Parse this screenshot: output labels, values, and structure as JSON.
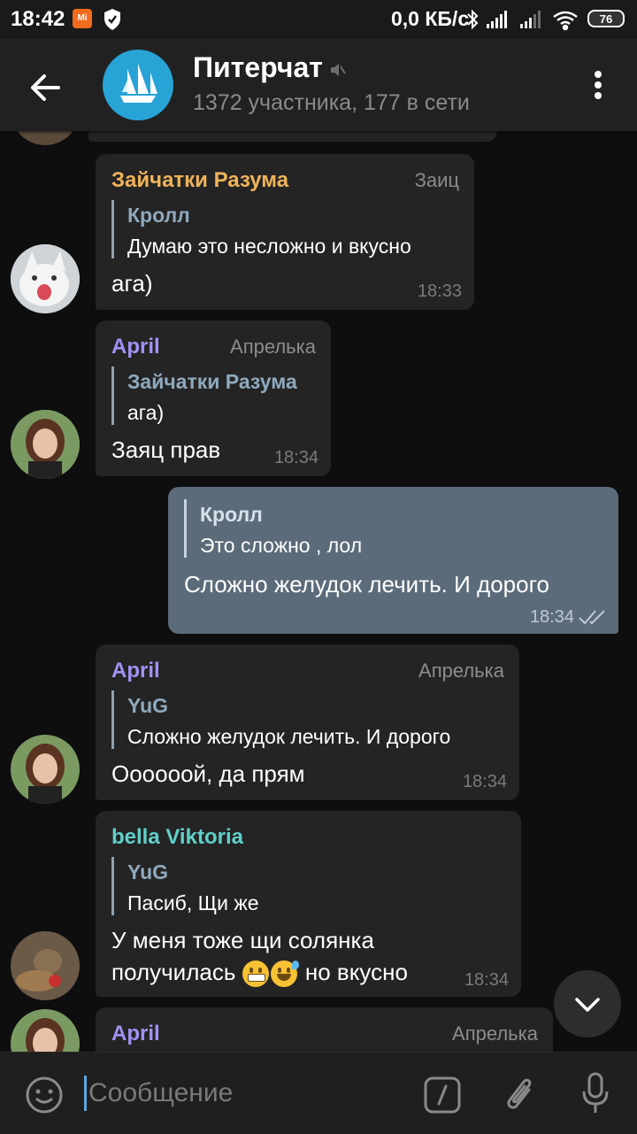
{
  "status": {
    "time": "18:42",
    "network": "0,0 КБ/с",
    "battery": "76",
    "mi_label": "Mi"
  },
  "header": {
    "title": "Питерчат",
    "subtitle": "1372 участника, 177 в сети"
  },
  "messages": [
    {
      "sender": "Зайчатки Разума",
      "alias": "Заиц",
      "reply_name": "Кролл",
      "reply_text": "Думаю это несложно и вкусно",
      "text": "ага)",
      "time": "18:33"
    },
    {
      "sender": "April",
      "alias": "Апрелька",
      "reply_name": "Зайчатки Разума",
      "reply_text": "ага)",
      "text": "Заяц прав",
      "time": "18:34"
    },
    {
      "reply_name": "Кролл",
      "reply_text": "Это сложно , лол",
      "text": "Сложно желудок лечить. И дорого",
      "time": "18:34"
    },
    {
      "sender": "April",
      "alias": "Апрелька",
      "reply_name": "YuG",
      "reply_text": "Сложно желудок лечить. И дорого",
      "text": "Оооооой, да прям",
      "time": "18:34"
    },
    {
      "sender": "bella Viktoria",
      "reply_name": "YuG",
      "reply_text": "Пасиб, Щи же",
      "text_line1": "У меня тоже щи солянка",
      "text_line2a": "получилась",
      "text_line2b": "но вкусно",
      "time": "18:34"
    },
    {
      "sender": "April",
      "alias": "Апрелька"
    }
  ],
  "colors": {
    "zaichatki": "#f0b35a",
    "april": "#9f93f4",
    "bella": "#5fd0c9",
    "outgoing_bubble": "#5b6b79",
    "incoming_bubble": "#242424"
  },
  "input": {
    "placeholder": "Сообщение"
  }
}
